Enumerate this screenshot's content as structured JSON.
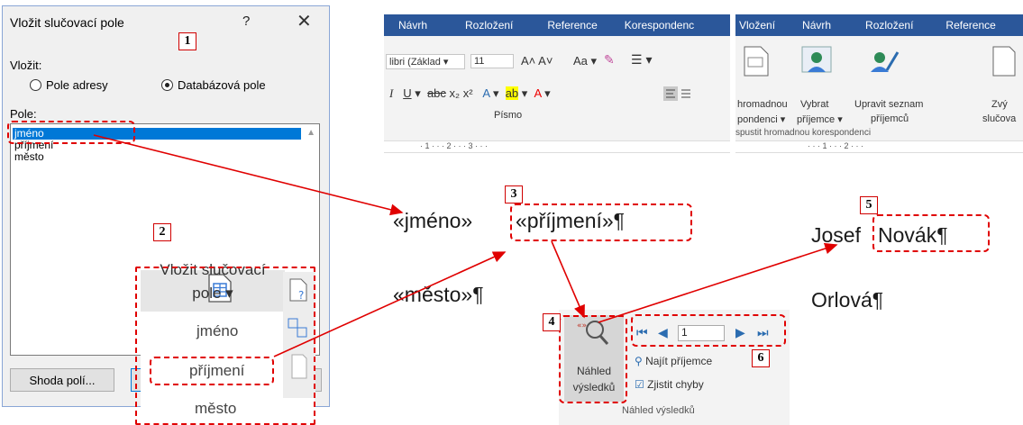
{
  "dialog": {
    "title": "Vložit slučovací pole",
    "help": "?",
    "close": "✕",
    "insert_label": "Vložit:",
    "radio_address": "Pole adresy",
    "radio_database": "Databázová pole",
    "fields_label": "Pole:",
    "fields": [
      "jméno",
      "příjmení",
      "město"
    ],
    "selected_index": 0,
    "match_button": "Shoda polí..."
  },
  "panel2": {
    "button_line1": "Vložit slučovací",
    "button_line2": "pole ▾",
    "items": [
      "jméno",
      "příjmení",
      "město"
    ]
  },
  "ribbon_mid": {
    "tabs": [
      "Návrh",
      "Rozložení",
      "Reference",
      "Korespondenc"
    ],
    "font_name": "libri (Základ ▾",
    "font_size": "11",
    "group_label": "Písmo",
    "ruler": "· 1 · · · 2 · · · 3 · · ·"
  },
  "document_mid": {
    "line1_a": "«jméno»",
    "line1_b": "«příjmení»¶",
    "line2": "«město»¶"
  },
  "preview_group": {
    "button_line1": "Náhled",
    "button_line2": "výsledků",
    "record": "1",
    "find": "Najít příjemce",
    "check": "Zjistit chyby",
    "group_label": "Náhled výsledků"
  },
  "ribbon_right": {
    "tabs": [
      "Vložení",
      "Návrh",
      "Rozložení",
      "Reference"
    ],
    "btn1_l1": "hromadnou",
    "btn1_l2": "pondenci ▾",
    "btn2_l1": "Vybrat",
    "btn2_l2": "příjemce ▾",
    "btn3_l1": "Upravit seznam",
    "btn3_l2": "příjemců",
    "btn4_l1": "Zvý",
    "btn4_l2": "slučova",
    "group_label": "spustit hromadnou korespondenci"
  },
  "document_right": {
    "line1_a": "Josef",
    "line1_b": "Novák¶",
    "line2": "Orlová¶"
  },
  "badges": [
    "1",
    "2",
    "3",
    "4",
    "5",
    "6"
  ],
  "colors": {
    "annotation": "#e00000",
    "ribbon": "#2b579a",
    "selection": "#0078d7"
  }
}
